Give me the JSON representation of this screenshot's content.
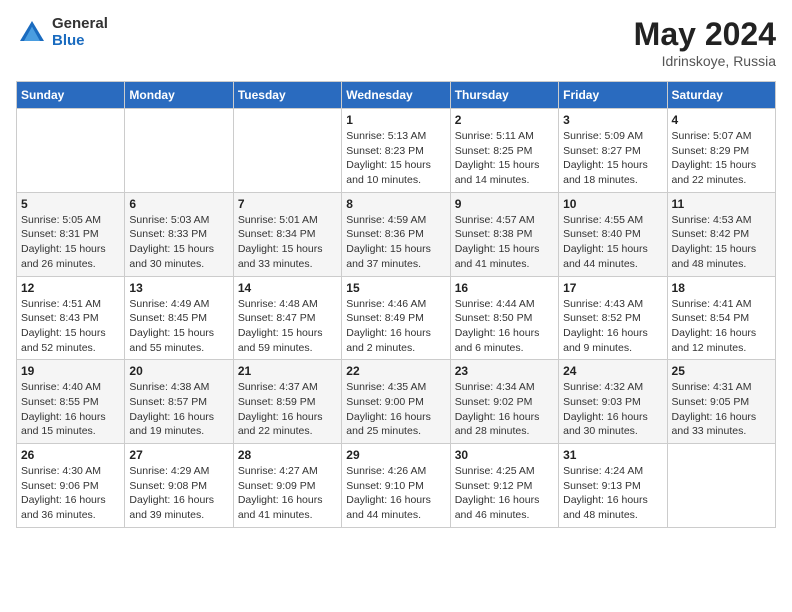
{
  "header": {
    "logo": {
      "general": "General",
      "blue": "Blue"
    },
    "title": "May 2024",
    "location": "Idrinskoye, Russia"
  },
  "days_of_week": [
    "Sunday",
    "Monday",
    "Tuesday",
    "Wednesday",
    "Thursday",
    "Friday",
    "Saturday"
  ],
  "weeks": [
    [
      {
        "day": "",
        "info": ""
      },
      {
        "day": "",
        "info": ""
      },
      {
        "day": "",
        "info": ""
      },
      {
        "day": "1",
        "info": "Sunrise: 5:13 AM\nSunset: 8:23 PM\nDaylight: 15 hours and 10 minutes."
      },
      {
        "day": "2",
        "info": "Sunrise: 5:11 AM\nSunset: 8:25 PM\nDaylight: 15 hours and 14 minutes."
      },
      {
        "day": "3",
        "info": "Sunrise: 5:09 AM\nSunset: 8:27 PM\nDaylight: 15 hours and 18 minutes."
      },
      {
        "day": "4",
        "info": "Sunrise: 5:07 AM\nSunset: 8:29 PM\nDaylight: 15 hours and 22 minutes."
      }
    ],
    [
      {
        "day": "5",
        "info": "Sunrise: 5:05 AM\nSunset: 8:31 PM\nDaylight: 15 hours and 26 minutes."
      },
      {
        "day": "6",
        "info": "Sunrise: 5:03 AM\nSunset: 8:33 PM\nDaylight: 15 hours and 30 minutes."
      },
      {
        "day": "7",
        "info": "Sunrise: 5:01 AM\nSunset: 8:34 PM\nDaylight: 15 hours and 33 minutes."
      },
      {
        "day": "8",
        "info": "Sunrise: 4:59 AM\nSunset: 8:36 PM\nDaylight: 15 hours and 37 minutes."
      },
      {
        "day": "9",
        "info": "Sunrise: 4:57 AM\nSunset: 8:38 PM\nDaylight: 15 hours and 41 minutes."
      },
      {
        "day": "10",
        "info": "Sunrise: 4:55 AM\nSunset: 8:40 PM\nDaylight: 15 hours and 44 minutes."
      },
      {
        "day": "11",
        "info": "Sunrise: 4:53 AM\nSunset: 8:42 PM\nDaylight: 15 hours and 48 minutes."
      }
    ],
    [
      {
        "day": "12",
        "info": "Sunrise: 4:51 AM\nSunset: 8:43 PM\nDaylight: 15 hours and 52 minutes."
      },
      {
        "day": "13",
        "info": "Sunrise: 4:49 AM\nSunset: 8:45 PM\nDaylight: 15 hours and 55 minutes."
      },
      {
        "day": "14",
        "info": "Sunrise: 4:48 AM\nSunset: 8:47 PM\nDaylight: 15 hours and 59 minutes."
      },
      {
        "day": "15",
        "info": "Sunrise: 4:46 AM\nSunset: 8:49 PM\nDaylight: 16 hours and 2 minutes."
      },
      {
        "day": "16",
        "info": "Sunrise: 4:44 AM\nSunset: 8:50 PM\nDaylight: 16 hours and 6 minutes."
      },
      {
        "day": "17",
        "info": "Sunrise: 4:43 AM\nSunset: 8:52 PM\nDaylight: 16 hours and 9 minutes."
      },
      {
        "day": "18",
        "info": "Sunrise: 4:41 AM\nSunset: 8:54 PM\nDaylight: 16 hours and 12 minutes."
      }
    ],
    [
      {
        "day": "19",
        "info": "Sunrise: 4:40 AM\nSunset: 8:55 PM\nDaylight: 16 hours and 15 minutes."
      },
      {
        "day": "20",
        "info": "Sunrise: 4:38 AM\nSunset: 8:57 PM\nDaylight: 16 hours and 19 minutes."
      },
      {
        "day": "21",
        "info": "Sunrise: 4:37 AM\nSunset: 8:59 PM\nDaylight: 16 hours and 22 minutes."
      },
      {
        "day": "22",
        "info": "Sunrise: 4:35 AM\nSunset: 9:00 PM\nDaylight: 16 hours and 25 minutes."
      },
      {
        "day": "23",
        "info": "Sunrise: 4:34 AM\nSunset: 9:02 PM\nDaylight: 16 hours and 28 minutes."
      },
      {
        "day": "24",
        "info": "Sunrise: 4:32 AM\nSunset: 9:03 PM\nDaylight: 16 hours and 30 minutes."
      },
      {
        "day": "25",
        "info": "Sunrise: 4:31 AM\nSunset: 9:05 PM\nDaylight: 16 hours and 33 minutes."
      }
    ],
    [
      {
        "day": "26",
        "info": "Sunrise: 4:30 AM\nSunset: 9:06 PM\nDaylight: 16 hours and 36 minutes."
      },
      {
        "day": "27",
        "info": "Sunrise: 4:29 AM\nSunset: 9:08 PM\nDaylight: 16 hours and 39 minutes."
      },
      {
        "day": "28",
        "info": "Sunrise: 4:27 AM\nSunset: 9:09 PM\nDaylight: 16 hours and 41 minutes."
      },
      {
        "day": "29",
        "info": "Sunrise: 4:26 AM\nSunset: 9:10 PM\nDaylight: 16 hours and 44 minutes."
      },
      {
        "day": "30",
        "info": "Sunrise: 4:25 AM\nSunset: 9:12 PM\nDaylight: 16 hours and 46 minutes."
      },
      {
        "day": "31",
        "info": "Sunrise: 4:24 AM\nSunset: 9:13 PM\nDaylight: 16 hours and 48 minutes."
      },
      {
        "day": "",
        "info": ""
      }
    ]
  ]
}
